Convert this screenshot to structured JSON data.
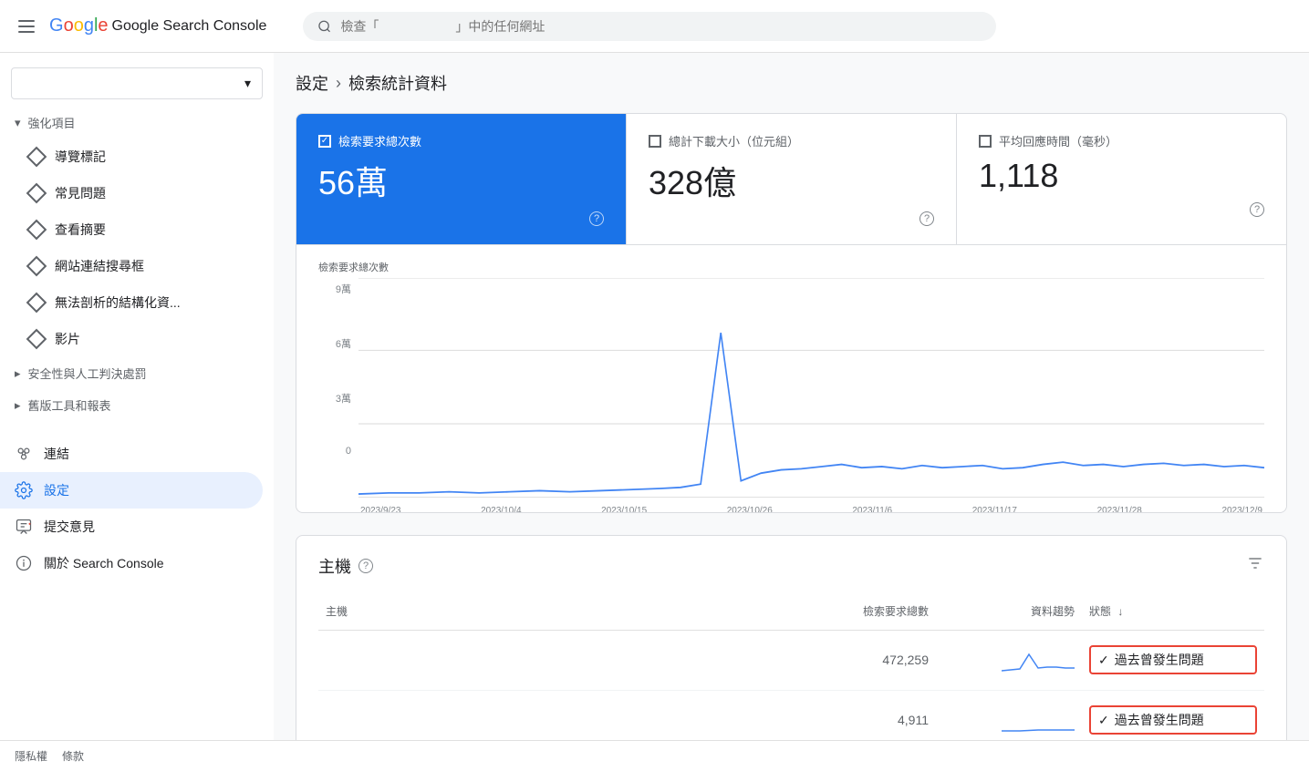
{
  "header": {
    "menu_icon": "hamburger-menu",
    "logo_text": "Google Search Console",
    "search_placeholder": "檢查「　　　　　　」中的任何網址"
  },
  "sidebar": {
    "dropdown_placeholder": "",
    "sections": [
      {
        "id": "enhancements",
        "label": "強化項目",
        "expanded": true,
        "items": [
          {
            "id": "breadcrumb",
            "label": "導覽標記",
            "icon": "diamond"
          },
          {
            "id": "faq",
            "label": "常見問題",
            "icon": "diamond"
          },
          {
            "id": "summary",
            "label": "查看摘要",
            "icon": "diamond"
          },
          {
            "id": "site-links",
            "label": "網站連結搜尋框",
            "icon": "diamond"
          },
          {
            "id": "structured",
            "label": "無法剖析的結構化資...",
            "icon": "diamond"
          },
          {
            "id": "video",
            "label": "影片",
            "icon": "diamond"
          }
        ]
      },
      {
        "id": "security",
        "label": "安全性與人工判決處罰",
        "expanded": false,
        "items": []
      },
      {
        "id": "legacy",
        "label": "舊版工具和報表",
        "expanded": false,
        "items": []
      }
    ],
    "bottom_items": [
      {
        "id": "links",
        "label": "連結",
        "icon": "links"
      },
      {
        "id": "settings",
        "label": "設定",
        "icon": "settings",
        "active": true
      },
      {
        "id": "feedback",
        "label": "提交意見",
        "icon": "feedback"
      },
      {
        "id": "about",
        "label": "關於 Search Console",
        "icon": "info"
      }
    ]
  },
  "breadcrumb": {
    "parent": "設定",
    "separator": "›",
    "current": "檢索統計資料"
  },
  "stats": {
    "cards": [
      {
        "id": "total-requests",
        "label": "檢索要求總次數",
        "value": "56萬",
        "active": true
      },
      {
        "id": "total-download",
        "label": "總計下載大小（位元組）",
        "value": "328億",
        "active": false
      },
      {
        "id": "avg-response",
        "label": "平均回應時間（毫秒）",
        "value": "1,118",
        "active": false
      }
    ]
  },
  "chart": {
    "y_axis_label": "檢索要求總次數",
    "y_max": "9萬",
    "y_mid1": "6萬",
    "y_mid2": "3萬",
    "y_zero": "0",
    "x_labels": [
      "2023/9/23",
      "2023/10/4",
      "2023/10/15",
      "2023/10/26",
      "2023/11/6",
      "2023/11/17",
      "2023/11/28",
      "2023/12/9"
    ]
  },
  "host_table": {
    "title": "主機",
    "columns": [
      {
        "id": "host",
        "label": "主機"
      },
      {
        "id": "requests",
        "label": "檢索要求總數"
      },
      {
        "id": "trend",
        "label": "資料趨勢"
      },
      {
        "id": "status",
        "label": "狀態"
      }
    ],
    "rows": [
      {
        "host": "",
        "requests": "472,259",
        "trend": "sparkline1",
        "status": "過去曾發生問題",
        "status_type": "past-issue"
      },
      {
        "host": "",
        "requests": "4,911",
        "trend": "sparkline2",
        "status": "過去曾發生問題",
        "status_type": "past-issue"
      }
    ]
  },
  "footer": {
    "privacy": "隱私權",
    "terms": "條款"
  }
}
